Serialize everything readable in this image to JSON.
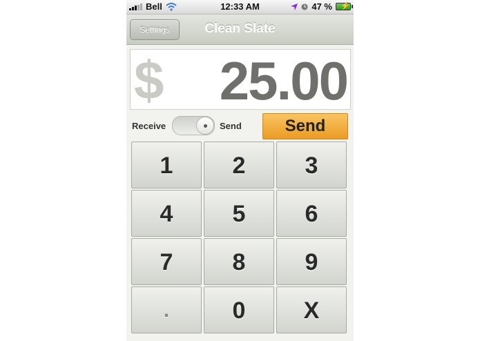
{
  "status_bar": {
    "carrier": "Bell",
    "time": "12:33 AM",
    "battery_percent": "47 %"
  },
  "nav": {
    "settings_label": "Settings",
    "title": "Clean Slate"
  },
  "amount": {
    "currency_symbol": "$",
    "value": "25.00"
  },
  "mode": {
    "left_label": "Receive",
    "right_label": "Send",
    "toggle_state": "Send"
  },
  "send_button": {
    "label": "Send",
    "color": "#f2a93a"
  },
  "keypad": [
    "1",
    "2",
    "3",
    "4",
    "5",
    "6",
    "7",
    "8",
    "9",
    ".",
    "0",
    "X"
  ]
}
